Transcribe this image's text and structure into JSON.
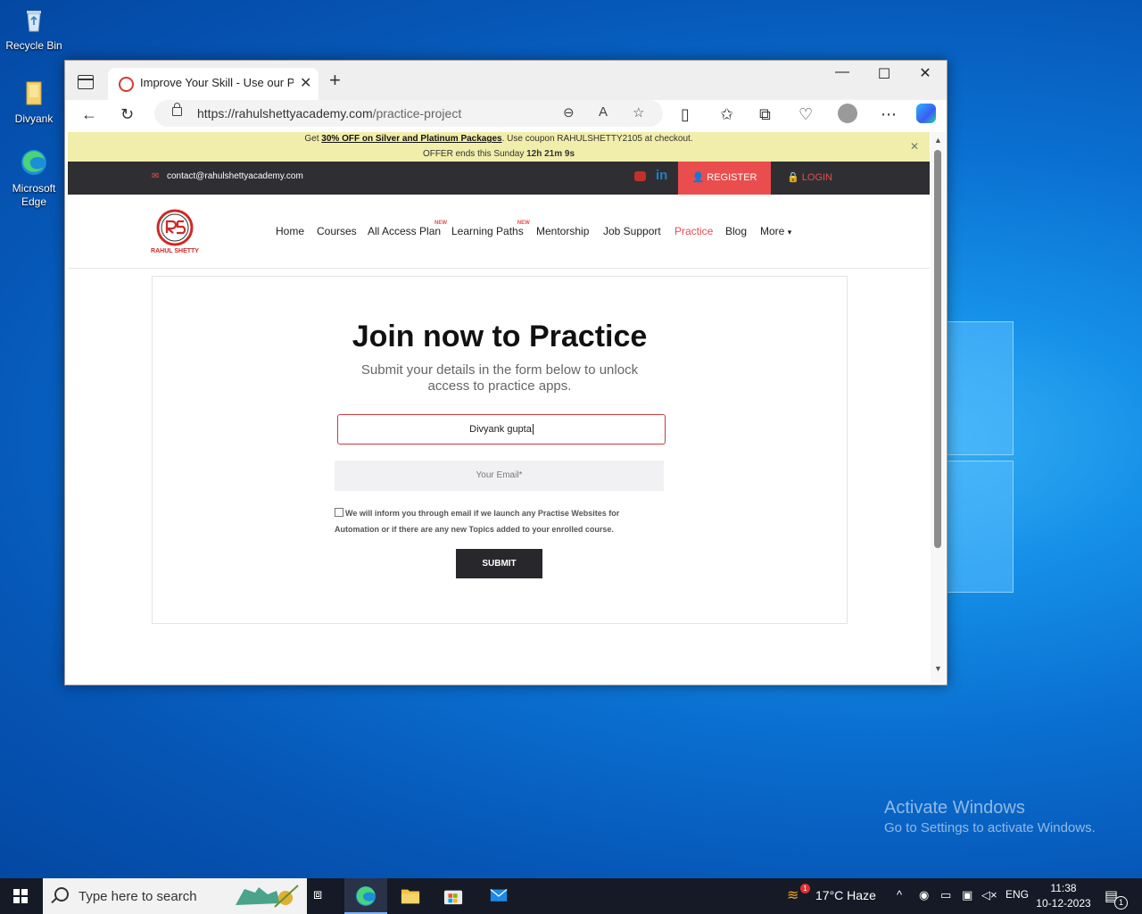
{
  "desktop": {
    "icons": [
      {
        "label": "Recycle Bin"
      },
      {
        "label": "Divyank"
      },
      {
        "label": "Microsoft Edge"
      }
    ],
    "watermark": {
      "line1": "Activate Windows",
      "line2": "Go to Settings to activate Windows."
    }
  },
  "browser": {
    "tab_title": "Improve Your Skill - Use our Practice",
    "url_host": "https://rahulshettyacademy.com",
    "url_path": "/practice-project"
  },
  "page": {
    "promo": {
      "prefix": "Get ",
      "link": "30% OFF on Silver and Platinum Packages",
      "mid": ". Use coupon RAHULSHETTY2105 at checkout.",
      "offer": "OFFER ends this Sunday ",
      "timer": "12h 21m 9s"
    },
    "topbar": {
      "email": "contact@rahulshettyacademy.com",
      "linkedin": "in",
      "register": "REGISTER",
      "login": "LOGIN"
    },
    "nav": {
      "logo_text": "RAHUL SHETTY",
      "new_badge": "NEW",
      "items": [
        "Home",
        "Courses",
        "All Access Plan",
        "Learning Paths",
        "Mentorship",
        "Job Support",
        "Practice",
        "Blog",
        "More"
      ]
    },
    "form": {
      "title": "Join now to Practice",
      "subtitle": "Submit your details in the form below to unlock access to practice apps.",
      "name_value": "Divyank gupta",
      "email_placeholder": "Your Email*",
      "consent": "We will inform you through email if we launch any Practise Websites for Automation or if there are any new Topics added to your enrolled course.",
      "submit": "SUBMIT"
    }
  },
  "taskbar": {
    "search_placeholder": "Type here to search",
    "weather_badge": "1",
    "weather": "17°C  Haze",
    "language": "ENG",
    "time": "11:38",
    "date": "10-12-2023",
    "notifications": "1"
  }
}
